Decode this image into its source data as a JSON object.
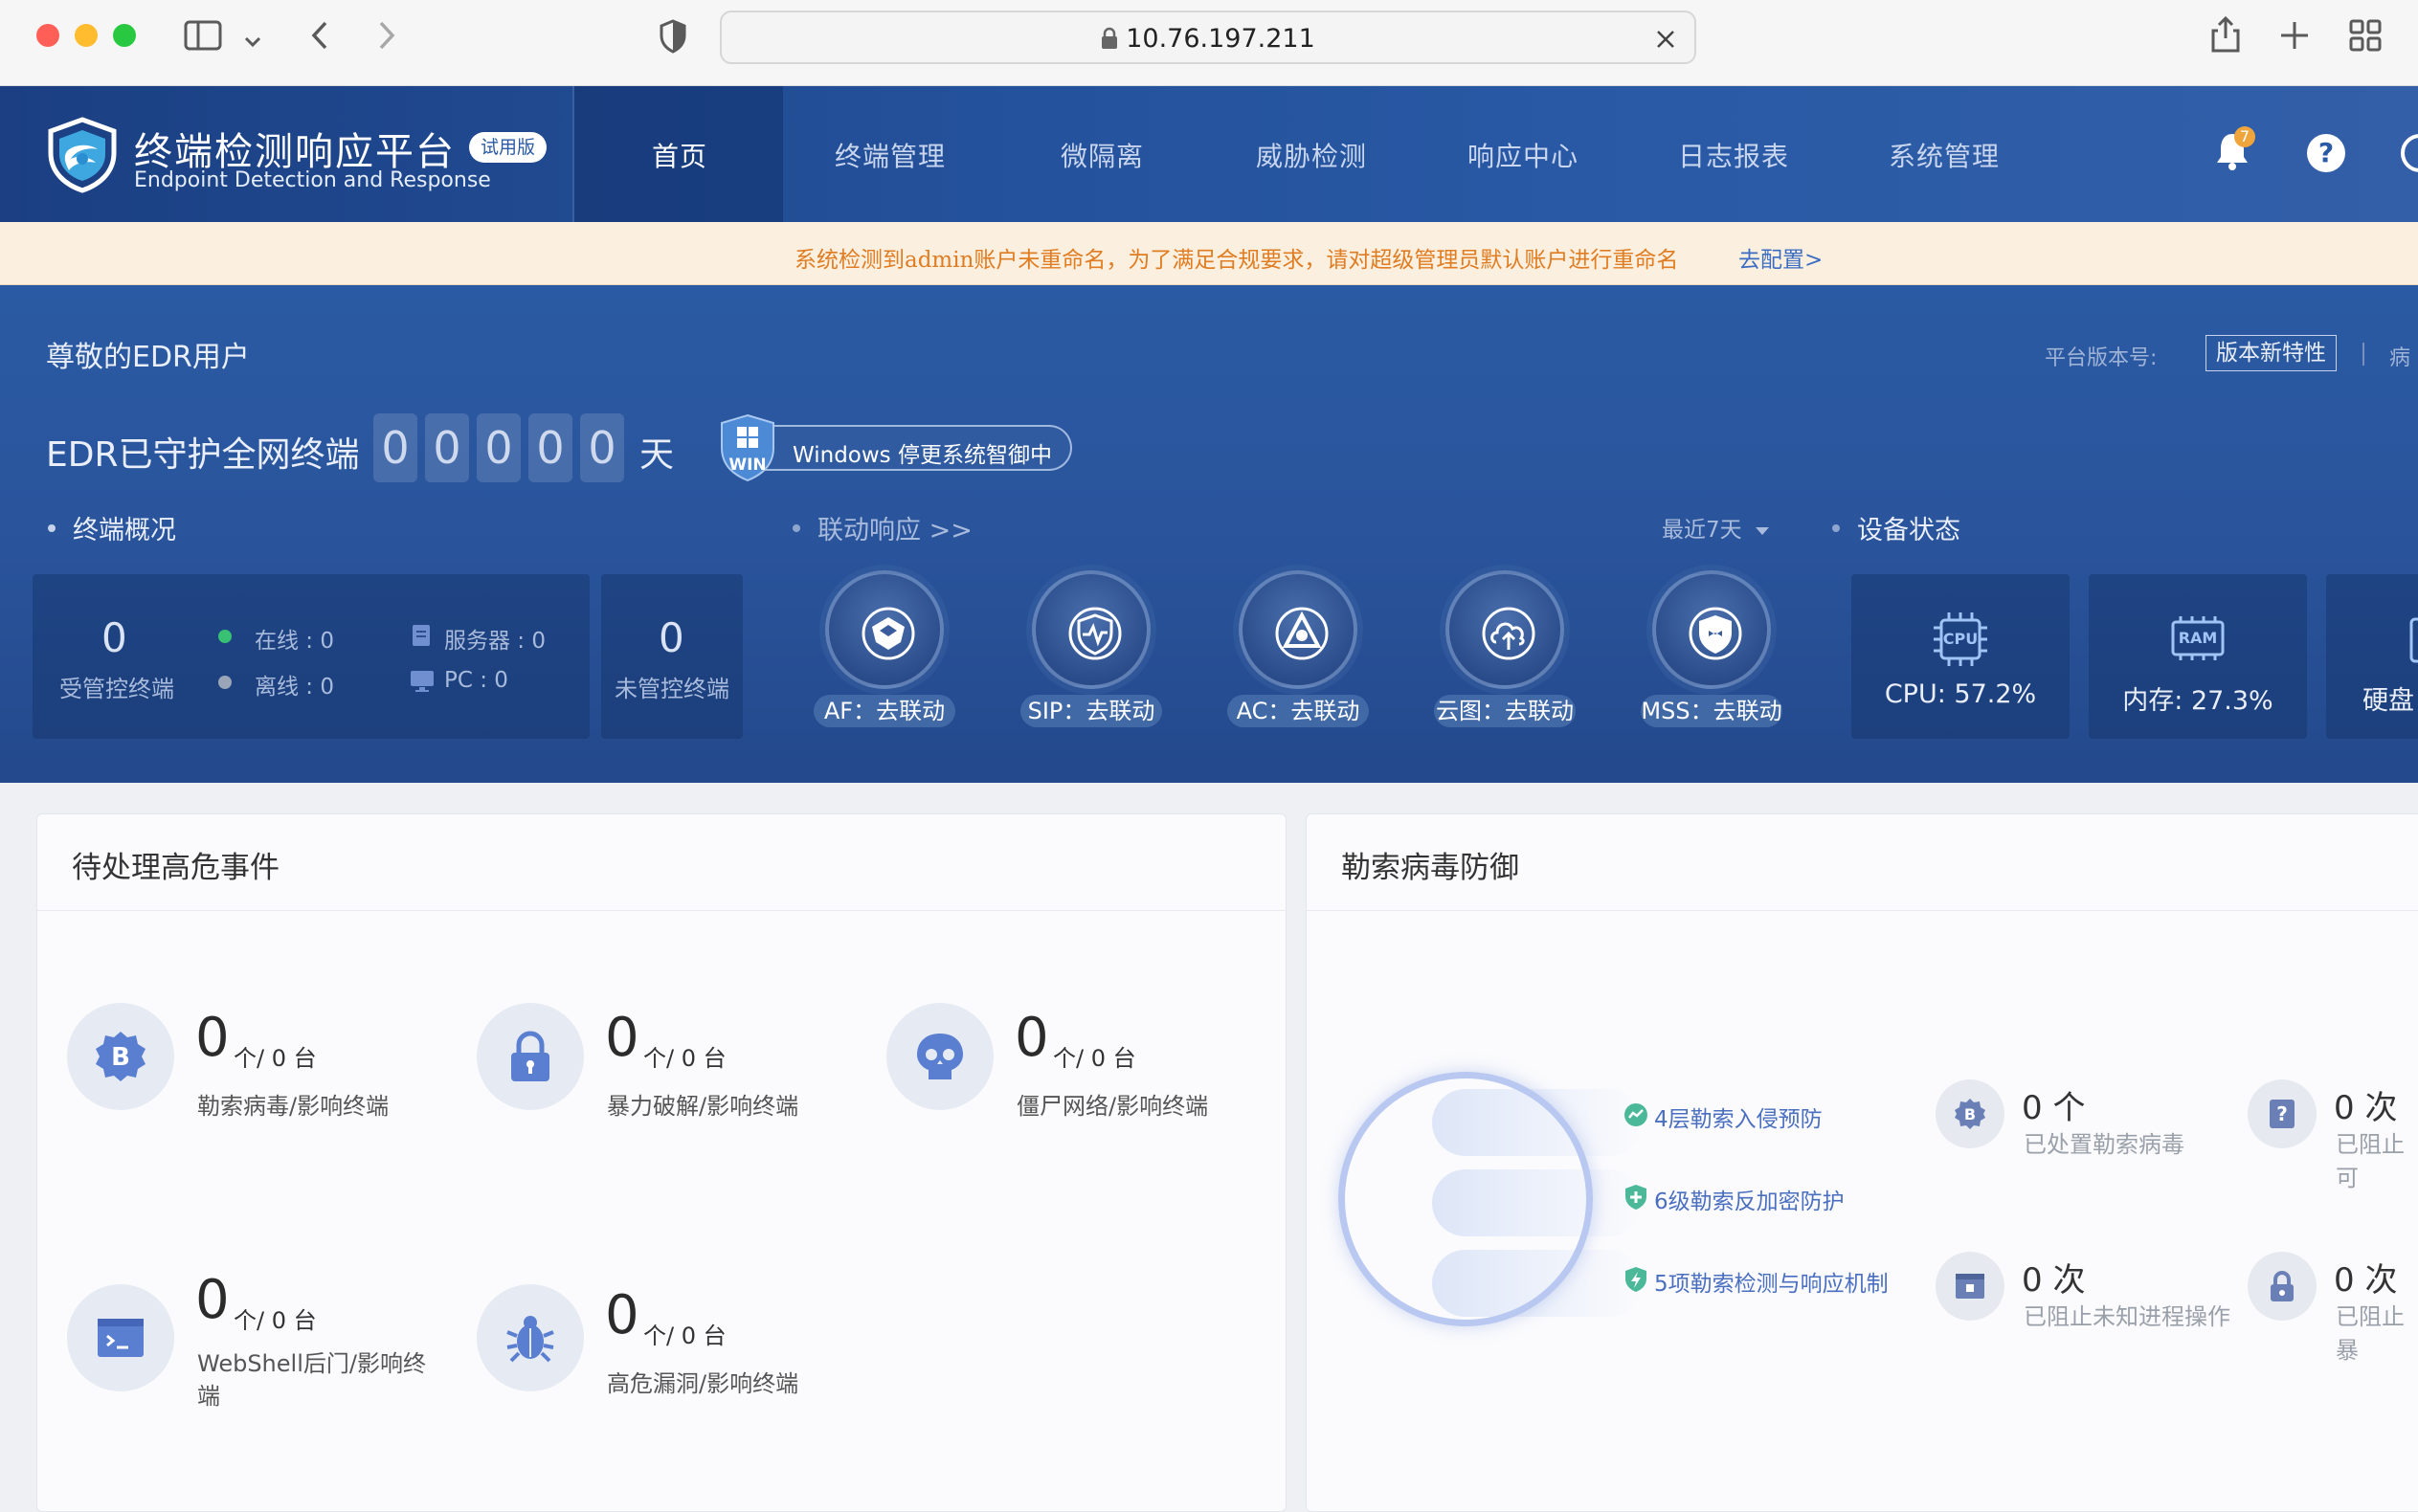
{
  "browser": {
    "url": "10.76.197.211",
    "colors": {
      "close": "#ff5f57",
      "minimize": "#febc2e",
      "maximize": "#28c840"
    }
  },
  "header": {
    "title": "终端检测响应平台",
    "subtitle": "Endpoint Detection and Response",
    "trial_badge": "试用版",
    "nav": [
      "首页",
      "终端管理",
      "微隔离",
      "威胁检测",
      "响应中心",
      "日志报表",
      "系统管理"
    ],
    "notification_count": "7",
    "help_glyph": "?"
  },
  "notice": {
    "text": "系统检测到admin账户未重命名，为了满足合规要求，请对超级管理员默认账户进行重命名",
    "link": "去配置>"
  },
  "hero": {
    "greeting": "尊敬的EDR用户",
    "version_label": "平台版本号:",
    "version_button": "版本新特性",
    "version_extra": "病",
    "guard_text": "EDR已守护全网终端",
    "days": [
      "0",
      "0",
      "0",
      "0",
      "0"
    ],
    "days_unit": "天",
    "windows_badge": "Windows 停更系统智御中",
    "win_label": "WIN"
  },
  "overview": {
    "title": "终端概况",
    "managed_count": "0",
    "managed_label": "受管控终端",
    "online": "在线 : 0",
    "offline": "离线 : 0",
    "server": "服务器 : 0",
    "pc": "PC : 0",
    "unmanaged_count": "0",
    "unmanaged_label": "未管控终端"
  },
  "linkage": {
    "title": "联动响应 >>",
    "range": "最近7天",
    "items": [
      "AF：去联动",
      "SIP：去联动",
      "AC：去联动",
      "云图：去联动",
      "MSS：去联动"
    ]
  },
  "device": {
    "title": "设备状态",
    "cpu": "CPU: 57.2%",
    "mem": "内存: 27.3%",
    "disk": "硬盘",
    "cpu_chip": "CPU",
    "ram_chip": "RAM"
  },
  "events": {
    "title": "待处理高危事件",
    "unit": "个/ 0 台",
    "items": [
      {
        "count": "0",
        "label": "勒索病毒/影响终端"
      },
      {
        "count": "0",
        "label": "暴力破解/影响终端"
      },
      {
        "count": "0",
        "label": "僵尸网络/影响终端"
      },
      {
        "count": "0",
        "label": "WebShell后门/影响终端"
      },
      {
        "count": "0",
        "label": "高危漏洞/影响终端"
      }
    ]
  },
  "ransomware": {
    "title": "勒索病毒防御",
    "features": [
      "4层勒索入侵预防",
      "6级勒索反加密防护",
      "5项勒索检测与响应机制"
    ],
    "stats": [
      {
        "value": "0 个",
        "label": "已处置勒索病毒"
      },
      {
        "value": "0 次",
        "label": "已阻止可"
      },
      {
        "value": "0 次",
        "label": "已阻止未知进程操作"
      },
      {
        "value": "0 次",
        "label": "已阻止暴"
      }
    ]
  }
}
